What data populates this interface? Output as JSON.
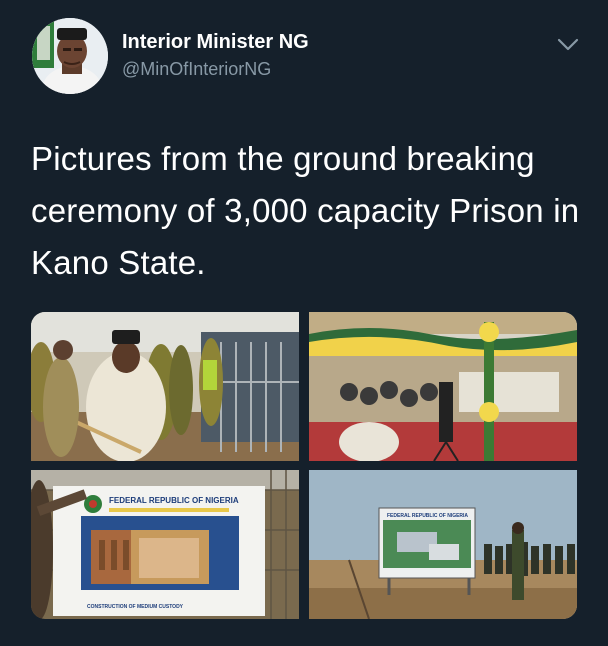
{
  "tweet": {
    "display_name": "Interior Minister NG",
    "handle": "@MinOfInteriorNG",
    "text": "Pictures from the ground breaking ceremony of 3,000 capacity Prison in Kano State."
  },
  "icons": {
    "menu": "chevron-down-icon",
    "avatar": "profile-avatar"
  },
  "colors": {
    "background": "#15202b",
    "secondary_text": "#8899a6"
  },
  "media": {
    "photo_sign_text": "FEDERAL REPUBLIC OF NIGERIA",
    "photo_sign_caption": "CONSTRUCTION OF MEDIUM CUSTODY"
  }
}
